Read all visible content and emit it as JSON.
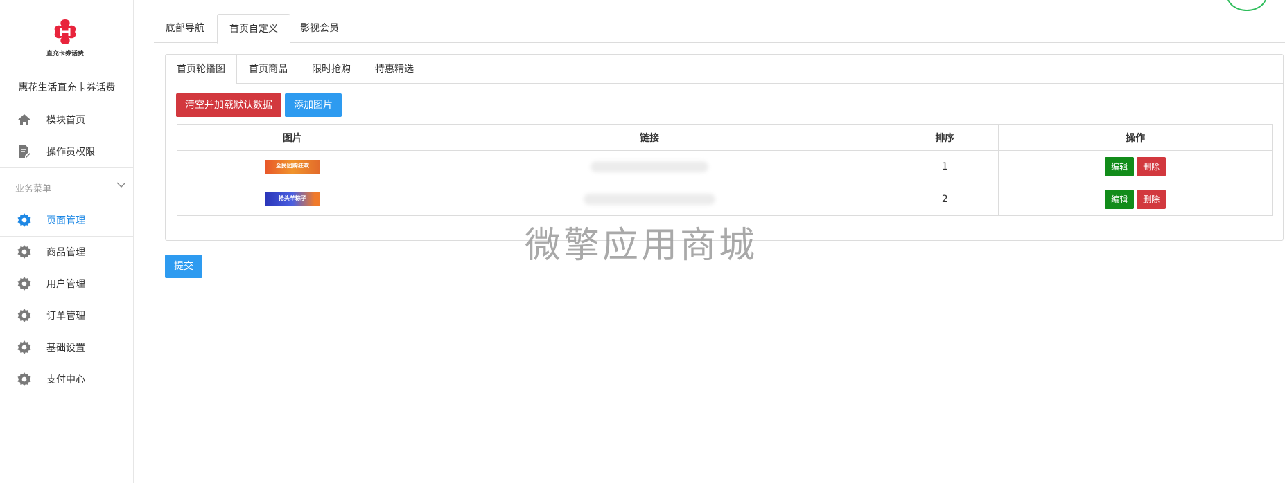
{
  "sidebar": {
    "logo_text": "直充卡券话费",
    "app_name": "惠花生活直充卡券话费",
    "nav_top": [
      {
        "label": "模块首页",
        "icon": "home-icon"
      },
      {
        "label": "操作员权限",
        "icon": "document-edit-icon"
      }
    ],
    "section_title": "业务菜单",
    "nav_business": [
      {
        "label": "页面管理",
        "icon": "gear-icon",
        "active": true
      },
      {
        "label": "商品管理",
        "icon": "gear-icon"
      },
      {
        "label": "用户管理",
        "icon": "gear-icon"
      },
      {
        "label": "订单管理",
        "icon": "gear-icon"
      },
      {
        "label": "基础设置",
        "icon": "gear-icon"
      },
      {
        "label": "支付中心",
        "icon": "gear-icon"
      }
    ]
  },
  "top_tabs": [
    {
      "label": "底部导航"
    },
    {
      "label": "首页自定义",
      "active": true
    },
    {
      "label": "影视会员"
    }
  ],
  "inner_tabs": [
    {
      "label": "首页轮播图",
      "active": true
    },
    {
      "label": "首页商品"
    },
    {
      "label": "限时抢购"
    },
    {
      "label": "特惠精选"
    }
  ],
  "toolbar": {
    "reset_label": "清空并加载默认数据",
    "add_image_label": "添加图片"
  },
  "table": {
    "headers": [
      "图片",
      "链接",
      "排序",
      "操作"
    ],
    "rows": [
      {
        "thumb_text": "全民团购狂欢",
        "sort": "1",
        "edit": "编辑",
        "delete": "删除"
      },
      {
        "thumb_text": "抢头羊粽子",
        "sort": "2",
        "edit": "编辑",
        "delete": "删除"
      }
    ]
  },
  "watermark": "微擎应用商城",
  "submit_label": "提交",
  "colors": {
    "accent": "#1e88e5",
    "primary_button": "#2e9bf0",
    "danger_button": "#d2383e",
    "success_button": "#128c1a"
  }
}
